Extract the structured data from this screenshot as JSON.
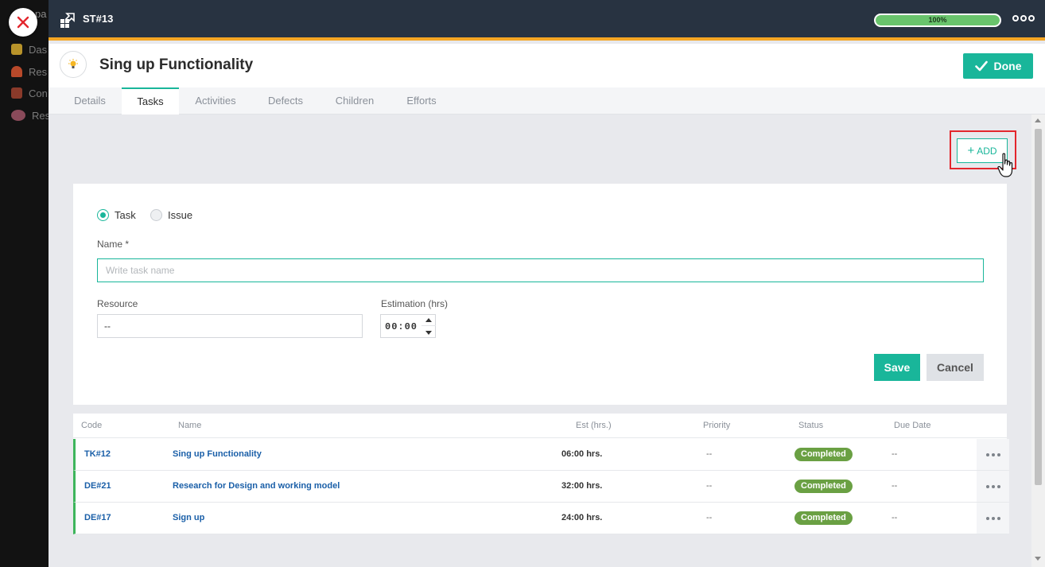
{
  "background_app": {
    "top_partial": "pa",
    "items": [
      "Das",
      "Res",
      "Con",
      "Res"
    ]
  },
  "topbar": {
    "code": "ST#13",
    "progress_value": 100,
    "progress_text": "100%"
  },
  "header": {
    "title": "Sing up Functionality",
    "done_label": "Done"
  },
  "tabs": [
    "Details",
    "Tasks",
    "Activities",
    "Defects",
    "Children",
    "Efforts"
  ],
  "active_tab": "Tasks",
  "toolbar": {
    "add_label": "ADD"
  },
  "form": {
    "type_options": [
      "Task",
      "Issue"
    ],
    "selected_type": "Task",
    "name_label": "Name *",
    "name_placeholder": "Write task name",
    "name_value": "",
    "resource_label": "Resource",
    "resource_value": "--",
    "estimation_label": "Estimation (hrs)",
    "estimation_value": "00:00",
    "save_label": "Save",
    "cancel_label": "Cancel"
  },
  "table": {
    "columns": [
      "Code",
      "Name",
      "Est (hrs.)",
      "Priority",
      "Status",
      "Due Date"
    ],
    "rows": [
      {
        "code": "TK#12",
        "name": "Sing up Functionality",
        "est": "06:00 hrs.",
        "priority": "--",
        "status": "Completed",
        "due": "--"
      },
      {
        "code": "DE#21",
        "name": "Research for Design and working model",
        "est": "32:00 hrs.",
        "priority": "--",
        "status": "Completed",
        "due": "--"
      },
      {
        "code": "DE#17",
        "name": "Sign up",
        "est": "24:00 hrs.",
        "priority": "--",
        "status": "Completed",
        "due": "--"
      }
    ]
  },
  "colors": {
    "accent": "#19b69a",
    "topbar": "#283341",
    "topbar_border": "#f5a623",
    "status_completed": "#6aa043",
    "highlight": "#e3262d"
  }
}
